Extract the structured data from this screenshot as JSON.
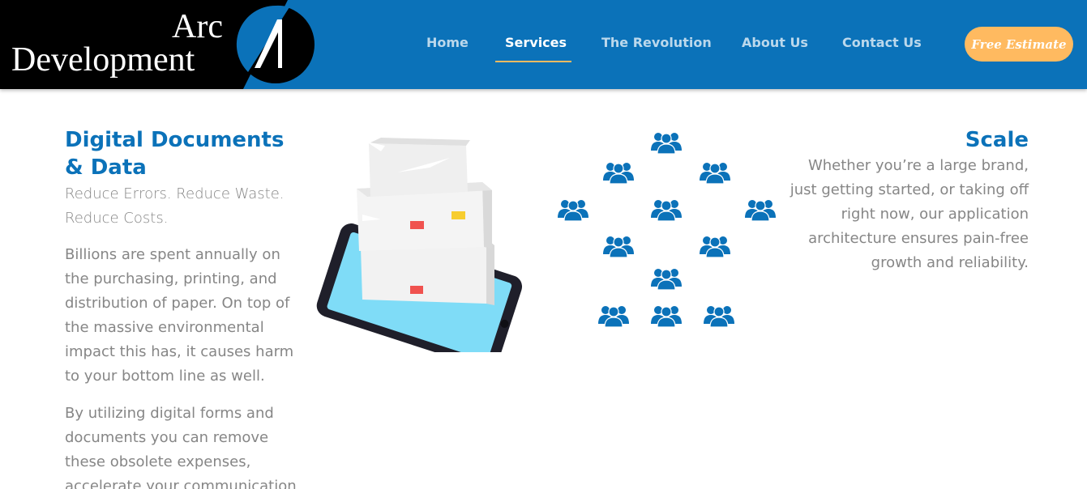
{
  "logo": {
    "line1": "Arc",
    "line2": "Development"
  },
  "nav": {
    "tabs": [
      {
        "label": "Home"
      },
      {
        "label": "Services"
      },
      {
        "label": "The Revolution"
      },
      {
        "label": "About Us"
      },
      {
        "label": "Contact Us"
      }
    ],
    "active_tab": "Services",
    "estimate_button": "Free Estimate"
  },
  "digital_documents": {
    "title": "Digital Documents & Data",
    "subtitle": "Reduce Errors. Reduce Waste. Reduce Costs.",
    "paragraph1": "Billions are spent annually on the purchasing, printing, and distribution of paper. On top of the massive environmental impact this has, it causes harm to your bottom line as well.",
    "paragraph2": "By utilizing digital forms and documents you can remove these obsolete expenses, accelerate your communication"
  },
  "scale": {
    "title": "Scale",
    "text": "Whether you’re a large brand, just getting started, or taking off right now, our application architecture ensures pain-free growth and reliability."
  },
  "colors": {
    "primary_blue": "#0b72b9",
    "accent_orange": "#ffba60",
    "text_grey": "#868686"
  },
  "icons": {
    "documents_illustration": "paper-stack-on-tablet",
    "scale_illustration": "people-groups-network"
  }
}
